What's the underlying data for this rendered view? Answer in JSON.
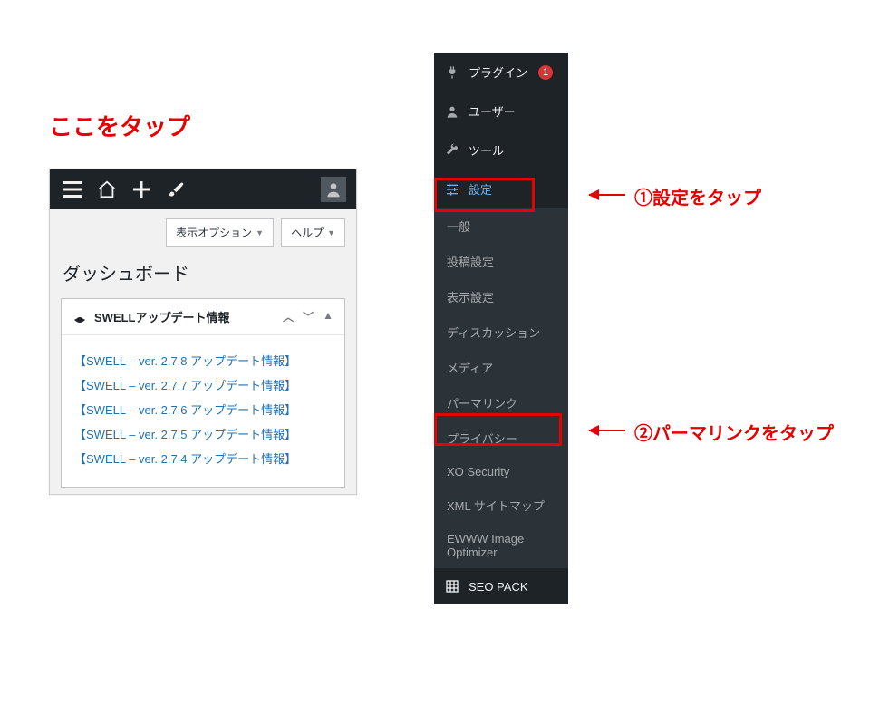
{
  "annotations": {
    "tap_here": "ここをタップ",
    "step1": "①設定をタップ",
    "step2": "②パーマリンクをタップ"
  },
  "adminbar": {
    "avatar": "avatar"
  },
  "dashboard": {
    "screen_options": "表示オプション",
    "help": "ヘルプ",
    "title": "ダッシュボード",
    "metabox_title": "SWELLアップデート情報",
    "updates": [
      "【SWELL – ver. 2.7.8 アップデート情報】",
      "【SWELL – ver. 2.7.7 アップデート情報】",
      "【SWELL – ver. 2.7.6 アップデート情報】",
      "【SWELL – ver. 2.7.5 アップデート情報】",
      "【SWELL – ver. 2.7.4 アップデート情報】"
    ]
  },
  "sidebar": {
    "plugins": "プラグイン",
    "plugins_badge": "1",
    "users": "ユーザー",
    "tools": "ツール",
    "settings": "設定",
    "submenu": {
      "general": "一般",
      "writing": "投稿設定",
      "reading": "表示設定",
      "discussion": "ディスカッション",
      "media": "メディア",
      "permalink": "パーマリンク",
      "privacy": "プライバシー",
      "xo_security": "XO Security",
      "xml_sitemap": "XML サイトマップ",
      "ewww": "EWWW Image Optimizer"
    },
    "seopack": "SEO PACK"
  }
}
